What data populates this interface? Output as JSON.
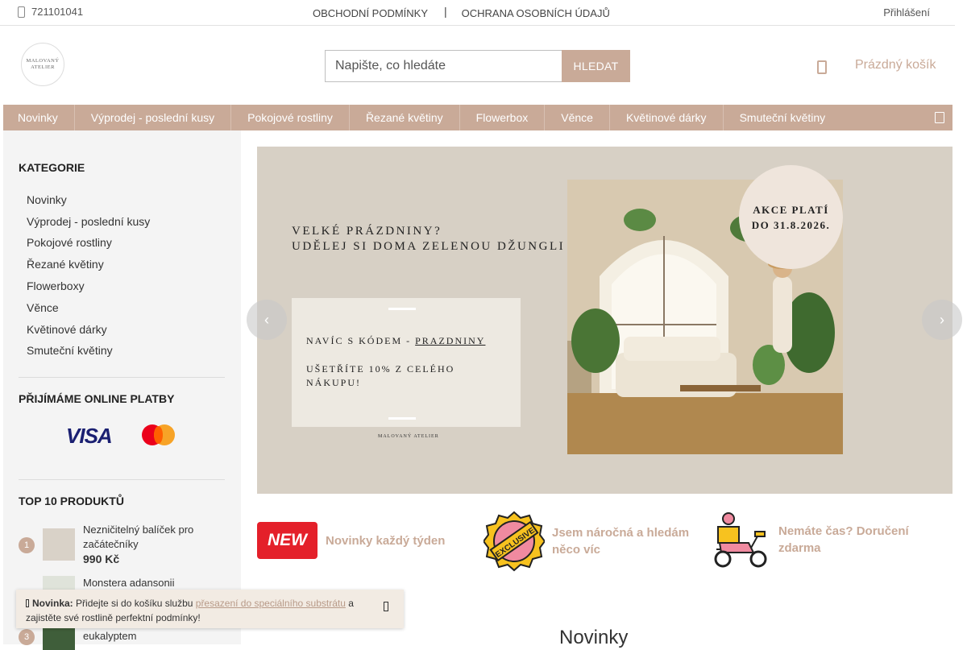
{
  "topbar": {
    "phone": "721101041",
    "links": [
      "OBCHODNÍ PODMÍNKY",
      "OCHRANA OSOBNÍCH ÚDAJŮ"
    ],
    "separator": "|",
    "login": "Přihlášení"
  },
  "header": {
    "logo_line1": "MALOVANÝ",
    "logo_line2": "ATELIER",
    "search_placeholder": "Napište, co hledáte",
    "search_button": "HLEDAT",
    "cart_label": "Prázdný košík"
  },
  "nav": {
    "items": [
      "Novinky",
      "Výprodej - poslední kusy",
      "Pokojové rostliny",
      "Řezané květiny",
      "Flowerbox",
      "Věnce",
      "Květinové dárky",
      "Smuteční květiny"
    ]
  },
  "sidebar": {
    "categories_title": "KATEGORIE",
    "categories": [
      "Novinky",
      "Výprodej - poslední kusy",
      "Pokojové rostliny",
      "Řezané květiny",
      "Flowerboxy",
      "Věnce",
      "Květinové dárky",
      "Smuteční květiny"
    ],
    "payments_title": "PŘIJÍMÁME ONLINE PLATBY",
    "visa_label": "VISA",
    "top_title": "TOP 10 PRODUKTŮ",
    "top_products": [
      {
        "rank": "1",
        "name": "Nezničitelný balíček pro začátečníky",
        "price": "990 Kč"
      },
      {
        "rank": "2",
        "name": "Monstera adansonii",
        "price": ""
      },
      {
        "rank": "3",
        "name": "Jarní věnec s pistácií a eukalyptem",
        "price": ""
      }
    ]
  },
  "banner": {
    "headline_line1": "VELKÉ PRÁZDNINY?",
    "headline_line2": "UDĚLEJ SI DOMA ZELENOU DŽUNGLI",
    "code_prefix": "NAVÍC S KÓDEM - ",
    "code": "PRAZDNINY",
    "save_line1": "UŠETŘÍTE 10% Z CELÉHO",
    "save_line2": "NÁKUPU!",
    "brand": "MALOVANÝ ATELIER",
    "promo_line1": "AKCE PLATÍ",
    "promo_line2": "DO 31.8.2026."
  },
  "features": [
    {
      "badge": "NEW",
      "text": "Novinky každý týden"
    },
    {
      "badge": "EXCLUSIVE",
      "text": "Jsem náročná a hledám něco víc"
    },
    {
      "badge": "scooter",
      "text": "Nemáte čas? Doručení zdarma"
    }
  ],
  "section": {
    "title": "Novinky"
  },
  "notice": {
    "label": "Novinka:",
    "text1": " Přidejte si do košíku službu ",
    "link": "přesazení do speciálního substrátu",
    "text2": " a zajistěte své rostlině perfektní podmínky!"
  },
  "colors": {
    "accent": "#c9aa98",
    "new_badge": "#e4202a",
    "visa": "#1a1f71"
  }
}
